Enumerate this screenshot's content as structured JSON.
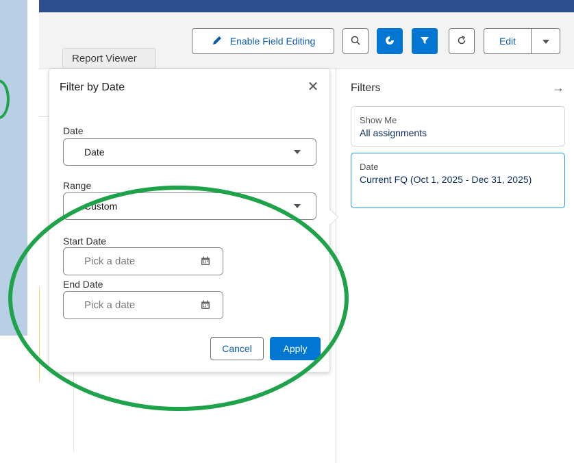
{
  "toolbar": {
    "field_editing_label": "Enable Field Editing",
    "edit_label": "Edit"
  },
  "tooltip": {
    "text": "Report Viewer"
  },
  "filter_popover": {
    "title": "Filter by Date",
    "date_label": "Date",
    "date_value": "Date",
    "range_label": "Range",
    "range_value": "Custom",
    "start_label": "Start Date",
    "start_placeholder": "Pick a date",
    "end_label": "End Date",
    "end_placeholder": "Pick a date",
    "cancel_label": "Cancel",
    "apply_label": "Apply"
  },
  "filters_panel": {
    "title": "Filters",
    "cards": [
      {
        "title": "Show Me",
        "value": "All assignments"
      },
      {
        "title": "Date",
        "value": "Current FQ (Oct 1, 2025 - Dec 31, 2025)"
      }
    ]
  },
  "colors": {
    "brand_blue": "#0176d3",
    "annotation_green": "#1ea34a",
    "header_navy": "#2c4e8f"
  },
  "icons": [
    "pencil-icon",
    "search-icon",
    "chart-icon",
    "filter-icon",
    "refresh-icon",
    "chevron-down-icon",
    "close-icon",
    "calendar-icon",
    "arrow-right-icon"
  ]
}
